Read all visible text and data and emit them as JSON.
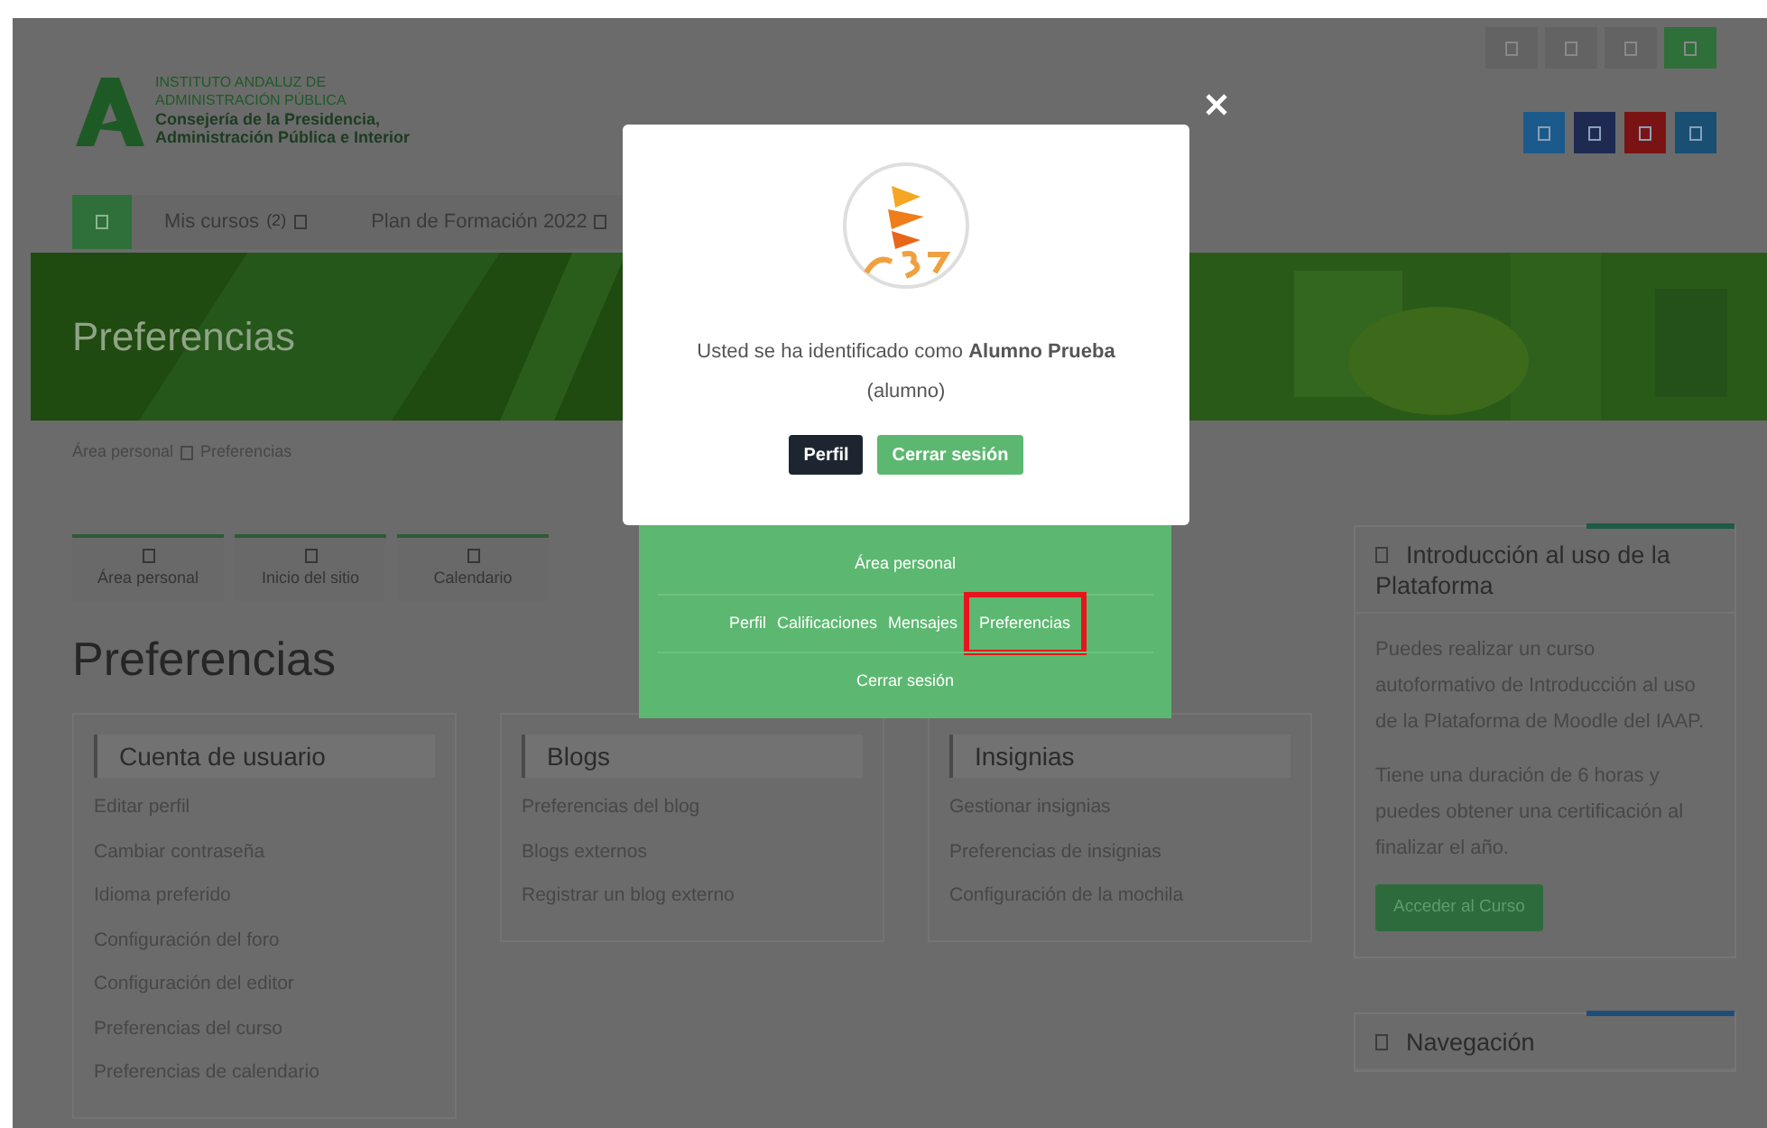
{
  "header": {
    "logo_lines": [
      {
        "text": "INSTITUTO ANDALUZ DE",
        "kind": "small"
      },
      {
        "text": "ADMINISTRACIÓN PÚBLICA",
        "kind": "small"
      },
      {
        "text": "Consejería de la Presidencia,",
        "kind": "bold"
      },
      {
        "text": "Administración Pública e Interior",
        "kind": "bold"
      }
    ],
    "top_buttons": [
      {
        "color": "#636363"
      },
      {
        "color": "#636363"
      },
      {
        "color": "#636363"
      },
      {
        "color": "#2f6f3a"
      }
    ],
    "social_buttons": [
      {
        "color": "#1c5a8c"
      },
      {
        "color": "#1e2a52"
      },
      {
        "color": "#7a1414"
      },
      {
        "color": "#184f73"
      }
    ]
  },
  "nav": [
    {
      "kind": "home",
      "selected": true
    },
    {
      "kind": "menu",
      "label": "Mis cursos",
      "count": "(2)",
      "selected": false
    },
    {
      "kind": "menu",
      "label": "Plan de Formación 2022",
      "selected": false
    }
  ],
  "banner": {
    "title": "Preferencias"
  },
  "breadcrumb": [
    "Área personal",
    "Preferencias"
  ],
  "quick_links": [
    "Área personal",
    "Inicio del sitio",
    "Calendario"
  ],
  "page_title": "Preferencias",
  "sections": [
    {
      "title": "Cuenta de usuario",
      "links": [
        "Editar perfil",
        "Cambiar contraseña",
        "Idioma preferido",
        "Configuración del foro",
        "Configuración del editor",
        "Preferencias del curso",
        "Preferencias de calendario"
      ]
    },
    {
      "title": "Blogs",
      "links": [
        "Preferencias del blog",
        "Blogs externos",
        "Registrar un blog externo"
      ]
    },
    {
      "title": "Insignias",
      "links": [
        "Gestionar insignias",
        "Preferencias de insignias",
        "Configuración de la mochila"
      ]
    }
  ],
  "sidebar_blocks": [
    {
      "title": "Introducción al uso de la Plataforma",
      "paragraphs": [
        "Puedes realizar un curso autoformativo de Introducción al uso de la Plataforma de Moodle del IAAP.",
        "Tiene una duración de 6 horas y puedes obtener una certificación al finalizar el año."
      ],
      "button": "Acceder al Curso",
      "color": "#1f5a48"
    },
    {
      "title": "Navegación",
      "color": "#1d4e7a"
    }
  ],
  "modal": {
    "message": "Usted se ha identificado como **Alumno Prueba**",
    "role": "(alumno)",
    "buttons": [
      {
        "label": "Perfil",
        "kind": "dark"
      },
      {
        "label": "Cerrar sesión",
        "kind": "green"
      }
    ]
  },
  "user_menu": {
    "rows": [
      [
        {
          "label": "Área personal",
          "highlighted": false
        }
      ],
      [
        {
          "label": "Perfil",
          "highlighted": false
        },
        {
          "label": "Calificaciones",
          "highlighted": false
        },
        {
          "label": "Mensajes",
          "highlighted": false
        },
        {
          "label": "Preferencias",
          "highlighted": true
        }
      ],
      [
        {
          "label": "Cerrar sesión",
          "highlighted": false
        }
      ]
    ]
  }
}
